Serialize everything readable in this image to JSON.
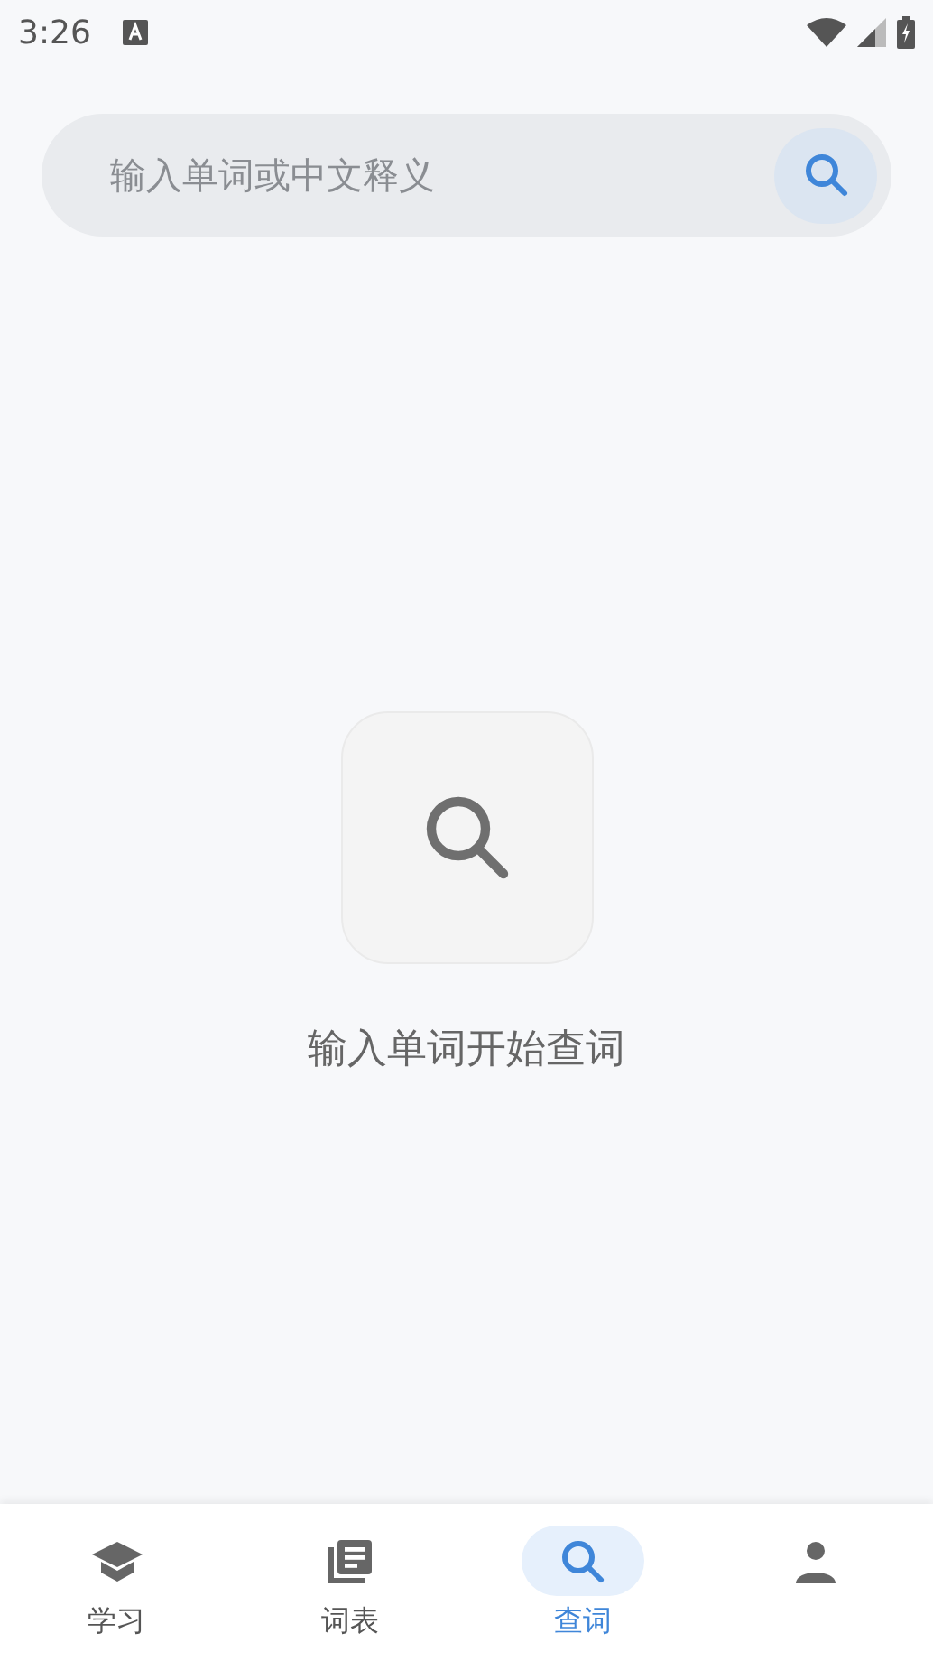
{
  "status_bar": {
    "time": "3:26"
  },
  "search": {
    "placeholder": "输入单词或中文释义"
  },
  "empty_state": {
    "message": "输入单词开始查词"
  },
  "bottom_nav": [
    {
      "kind": "cap",
      "label": "学习",
      "selected": false
    },
    {
      "kind": "list",
      "label": "词表",
      "selected": false
    },
    {
      "kind": "search",
      "label": "查词",
      "selected": true
    },
    {
      "kind": "person",
      "selected": false
    }
  ]
}
